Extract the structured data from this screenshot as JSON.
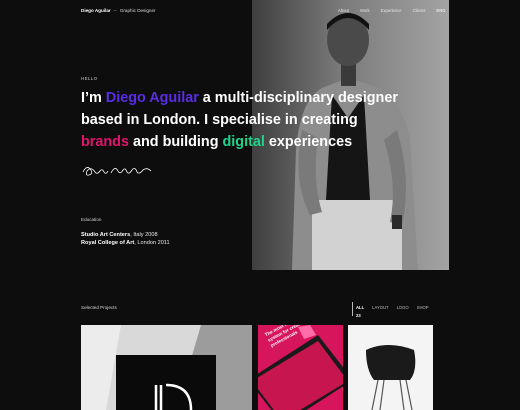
{
  "header": {
    "brand_name": "Diego Aguilar",
    "brand_sep": "–",
    "brand_role": "Graphic Designer",
    "nav": [
      "About",
      "Work",
      "Experience",
      "Clients"
    ],
    "nav_icon": "ENG",
    "nav_icon_name": "language-switch"
  },
  "hero": {
    "kicker": "HELLO",
    "line1_a": "I’m ",
    "line1_name": "Diego Aguilar",
    "line1_b": " a multi-disciplinary designer",
    "line2": "based in London. I specialise in creating",
    "line3_brands": "brands",
    "line3_mid": " and building ",
    "line3_digital": "digital",
    "line3_end": " experiences"
  },
  "education": {
    "title": "Education",
    "items": [
      {
        "school": "Studio Art Centers",
        "detail": ", Italy 2008"
      },
      {
        "school": "Royal College of Art",
        "detail": ", London 2011"
      }
    ]
  },
  "projects": {
    "title": "Selected Projects",
    "filters": [
      "ALL",
      "LAYOUT",
      "LOGO",
      "SHOP"
    ],
    "count": "23",
    "thumb2_text": "The most flexible portfolio system for creative professionals"
  },
  "colors": {
    "accent_purple": "#5a2ce6",
    "accent_pink": "#e0146e",
    "accent_green": "#1fd48a",
    "background": "#0d0d0d"
  }
}
